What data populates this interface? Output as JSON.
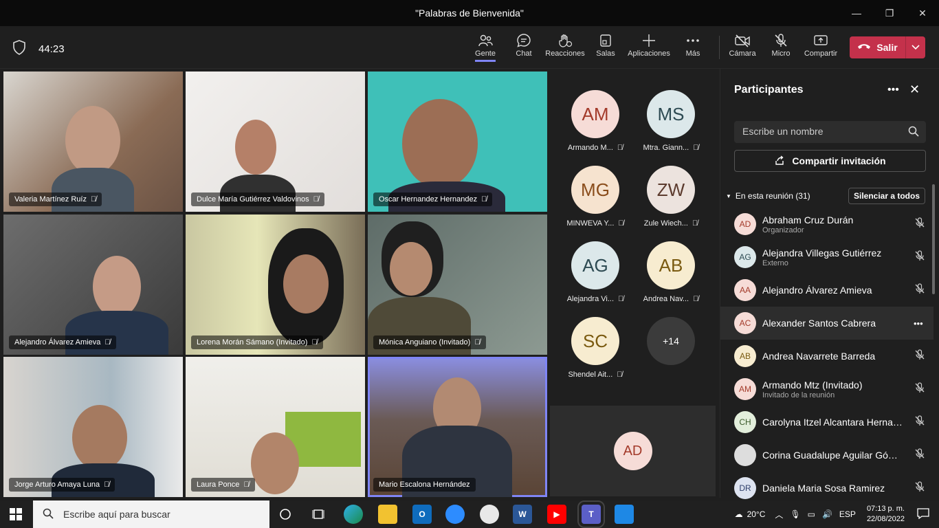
{
  "window": {
    "title": "\"Palabras de Bienvenida\"",
    "min": "—",
    "max": "❐",
    "close": "✕"
  },
  "toolbar": {
    "timer": "44:23",
    "buttons": [
      {
        "label": "Gente",
        "icon": "people-icon"
      },
      {
        "label": "Chat",
        "icon": "chat-icon"
      },
      {
        "label": "Reacciones",
        "icon": "hand-icon"
      },
      {
        "label": "Salas",
        "icon": "rooms-icon"
      },
      {
        "label": "Aplicaciones",
        "icon": "plus-icon"
      },
      {
        "label": "Más",
        "icon": "more-icon"
      },
      {
        "label": "Cámara",
        "icon": "camera-off-icon"
      },
      {
        "label": "Micro",
        "icon": "mic-off-icon"
      },
      {
        "label": "Compartir",
        "icon": "share-icon"
      }
    ],
    "leave_label": "Salir"
  },
  "video_tiles": [
    {
      "name": "Valeria Martínez Ruíz"
    },
    {
      "name": "Dulce María Gutiérrez Valdovinos"
    },
    {
      "name": "Oscar Hernandez Hernandez"
    },
    {
      "name": "Alejandro Álvarez Amieva"
    },
    {
      "name": "Lorena Morán Sámano (Invitado)"
    },
    {
      "name": "Mónica Anguiano (Invitado)"
    },
    {
      "name": "Jorge Arturo Amaya Luna"
    },
    {
      "name": "Laura Ponce"
    },
    {
      "name": "Mario Escalona Hernández"
    }
  ],
  "avatar_tiles": [
    {
      "initials": "AM",
      "name": "Armando M...",
      "bg": "#f6dcd7",
      "fg": "#a33a2a"
    },
    {
      "initials": "MS",
      "name": "Mtra. Giann...",
      "bg": "#dce8ea",
      "fg": "#2d4a52"
    },
    {
      "initials": "MG",
      "name": "MINWEVA Y...",
      "bg": "#f6e3cf",
      "fg": "#8a4d1b"
    },
    {
      "initials": "ZW",
      "name": "Zule Wiech...",
      "bg": "#ece3de",
      "fg": "#5c3b2e"
    },
    {
      "initials": "AG",
      "name": "Alejandra Vi...",
      "bg": "#dce8ea",
      "fg": "#2d4a52"
    },
    {
      "initials": "AB",
      "name": "Andrea Nav...",
      "bg": "#f7ecd0",
      "fg": "#7a5a10"
    },
    {
      "initials": "SC",
      "name": "Shendel Ait...",
      "bg": "#f7ecd0",
      "fg": "#7a5a10"
    }
  ],
  "overflow_count": "+14",
  "self_initials": "AD",
  "panel": {
    "title": "Participantes",
    "search_placeholder": "Escribe un nombre",
    "share_label": "Compartir invitación",
    "section_label": "En esta reunión (31)",
    "mute_all_label": "Silenciar a todos",
    "participants": [
      {
        "initials": "AD",
        "name": "Abraham Cruz Durán",
        "role": "Organizador",
        "bg": "#f6dcd7",
        "fg": "#a33a2a"
      },
      {
        "initials": "AG",
        "name": "Alejandra Villegas Gutiérrez",
        "role": "Externo",
        "bg": "#dce8ea",
        "fg": "#2d4a52"
      },
      {
        "initials": "AA",
        "name": "Alejandro Álvarez Amieva",
        "role": "",
        "bg": "#f6dcd7",
        "fg": "#a33a2a"
      },
      {
        "initials": "AC",
        "name": "Alexander Santos Cabrera",
        "role": "",
        "bg": "#f6dcd7",
        "fg": "#a33a2a"
      },
      {
        "initials": "AB",
        "name": "Andrea Navarrete Barreda",
        "role": "",
        "bg": "#f7ecd0",
        "fg": "#7a5a10"
      },
      {
        "initials": "AM",
        "name": "Armando Mtz (Invitado)",
        "role": "Invitado de la reunión",
        "bg": "#f6dcd7",
        "fg": "#a33a2a"
      },
      {
        "initials": "CH",
        "name": "Carolyna Itzel Alcantara Hernan...",
        "role": "",
        "bg": "#e2eedb",
        "fg": "#3b5a2b"
      },
      {
        "initials": "",
        "name": "Corina Guadalupe Aguilar Gómez",
        "role": "",
        "bg": "#ddd",
        "fg": "#333"
      },
      {
        "initials": "DR",
        "name": "Daniela Maria Sosa Ramirez",
        "role": "",
        "bg": "#dde3f0",
        "fg": "#2f3f6a"
      }
    ]
  },
  "taskbar": {
    "search_placeholder": "Escribe aquí para buscar",
    "weather": "20°C",
    "lang": "ESP",
    "time": "07:13 p. m.",
    "date": "22/08/2022"
  }
}
